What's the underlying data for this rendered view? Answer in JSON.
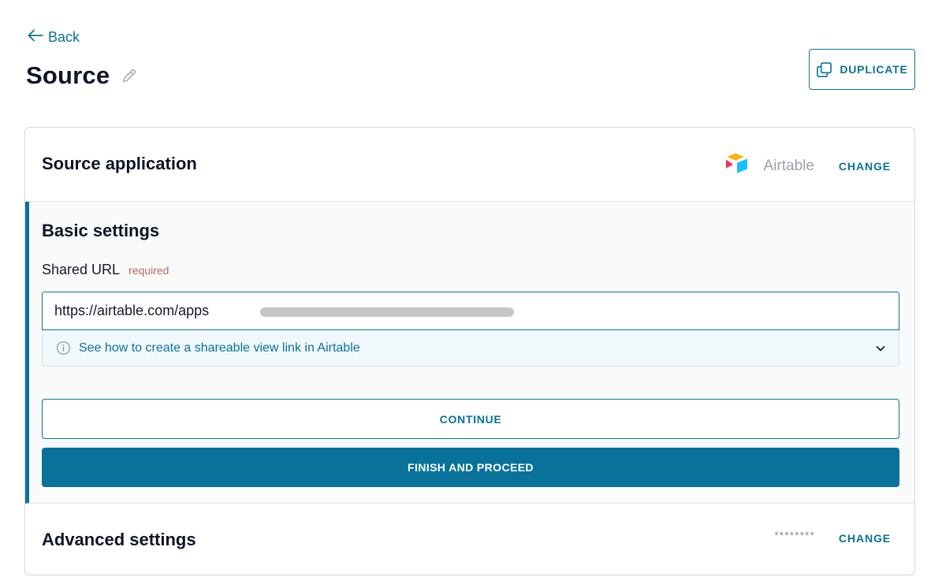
{
  "nav": {
    "back_label": "Back"
  },
  "page": {
    "title": "Source",
    "duplicate_label": "DUPLICATE"
  },
  "source_application": {
    "title": "Source application",
    "app_name": "Airtable",
    "change_label": "CHANGE",
    "logo_colors": {
      "top": "#FCB400",
      "left": "#F82B60",
      "right": "#18BFFF"
    }
  },
  "basic_settings": {
    "title": "Basic settings",
    "shared_url": {
      "label": "Shared URL",
      "required_label": "required",
      "value": "https://airtable.com/apps"
    },
    "help_text": "See how to create a shareable view link in Airtable",
    "continue_label": "CONTINUE",
    "finish_label": "FINISH AND PROCEED"
  },
  "advanced_settings": {
    "title": "Advanced settings",
    "masked_value": "********",
    "change_label": "CHANGE"
  },
  "colors": {
    "accent": "#0A7399",
    "required": "#C0665C"
  }
}
